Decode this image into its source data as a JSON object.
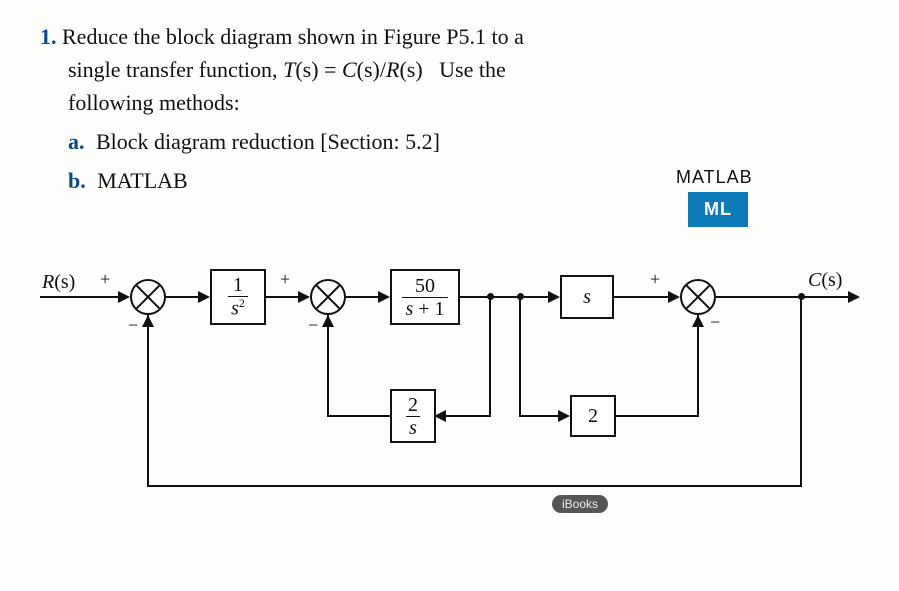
{
  "problem": {
    "number": "1.",
    "text_l1": "Reduce the block diagram shown in Figure P5.1 to a",
    "text_l2_pre": "single transfer function, ",
    "eq_T": "T",
    "eq_s1": "(s)",
    "eq_eq": " = ",
    "eq_C": "C",
    "eq_s2": "(s)",
    "eq_slash": "/",
    "eq_R": "R",
    "eq_s3": "(s)",
    "text_l2_post": " Use the",
    "text_l3": "following methods:",
    "a_label": "a.",
    "a_text": "Block diagram reduction [Section: 5.2]",
    "b_label": "b.",
    "b_text": "MATLAB"
  },
  "badges": {
    "matlab_label": "MATLAB",
    "ml": "ML"
  },
  "diagram": {
    "input_label_R": "R",
    "input_label_s": "(s)",
    "output_label_C": "C",
    "output_label_s": "(s)",
    "plus": "+",
    "minus": "−",
    "g1_num": "1",
    "g1_den": "s",
    "g1_sup": "2",
    "g2_num": "50",
    "g2_den": "s + 1",
    "g3": "s",
    "h1_num": "2",
    "h1_den": "s",
    "h2": "2",
    "ibooks": "iBooks"
  },
  "chart_data": {
    "type": "block-diagram",
    "input": "R(s)",
    "output": "C(s)",
    "summing_junctions": [
      {
        "id": "S1",
        "inputs": [
          {
            "sign": "+",
            "from": "R(s)"
          },
          {
            "sign": "-",
            "from": "C(s)_feedback"
          }
        ]
      },
      {
        "id": "S2",
        "inputs": [
          {
            "sign": "+",
            "from": "G1_out"
          },
          {
            "sign": "-",
            "from": "H1_out"
          }
        ]
      },
      {
        "id": "S3",
        "inputs": [
          {
            "sign": "+",
            "from": "G3_out"
          },
          {
            "sign": "-",
            "from": "H2_out"
          }
        ]
      }
    ],
    "blocks": [
      {
        "id": "G1",
        "tf": "1/s^2",
        "from": "S1",
        "to": "S2"
      },
      {
        "id": "G2",
        "tf": "50/(s+1)",
        "from": "S2",
        "to": "node_A"
      },
      {
        "id": "G3",
        "tf": "s",
        "from": "node_A",
        "to": "S3"
      },
      {
        "id": "H1",
        "tf": "2/s",
        "from": "node_A",
        "to": "S2",
        "feedback": true
      },
      {
        "id": "H2",
        "tf": "2",
        "from": "node_B_after_G3",
        "to": "S3",
        "feedback": true
      }
    ],
    "outer_feedback": {
      "from": "C(s)",
      "to": "S1",
      "gain": 1,
      "sign": "-"
    }
  }
}
